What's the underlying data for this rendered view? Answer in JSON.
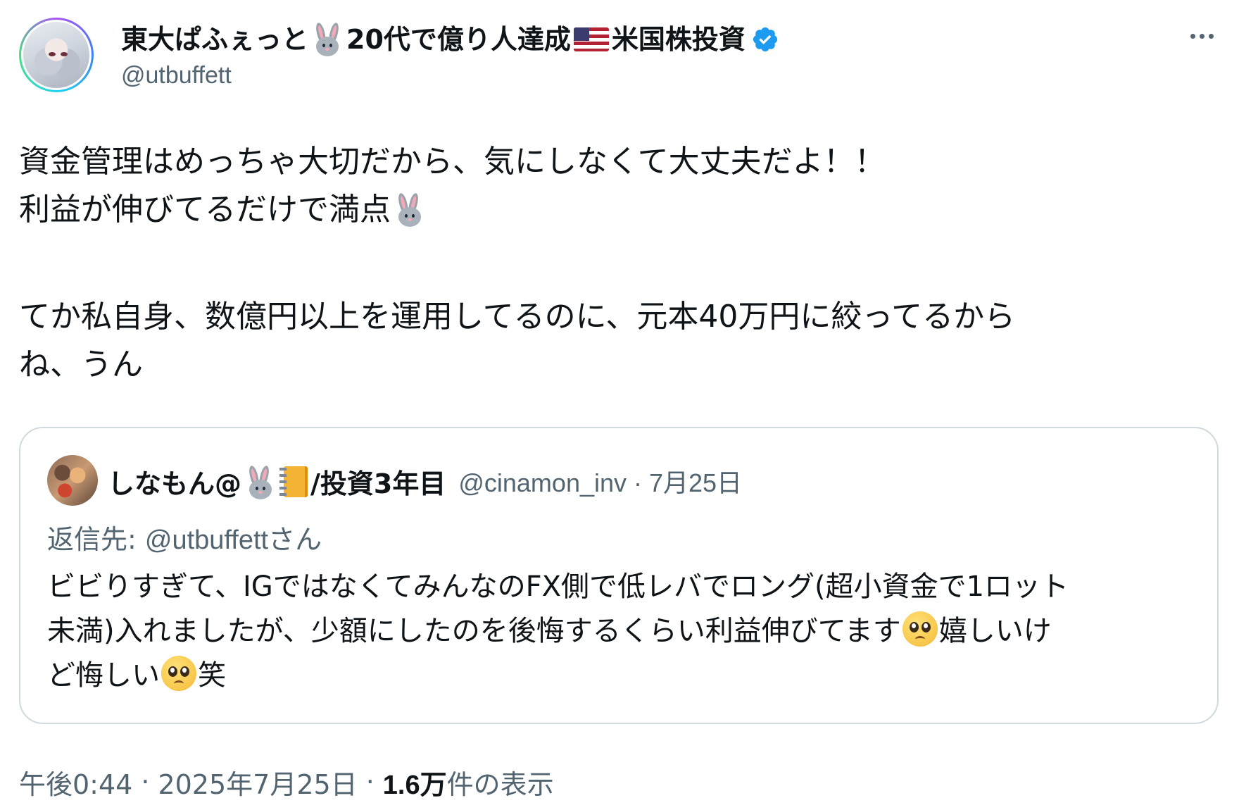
{
  "author": {
    "name_part1": "東大ぱふぇっと",
    "name_part2": "20代で億り人達成",
    "name_part3": "米国株投資",
    "handle": "@utbuffett",
    "verified": true,
    "emoji_icons": [
      "rabbit-face",
      "us-flag",
      "verified-badge"
    ]
  },
  "more_icon": "ellipsis-icon",
  "tweet": {
    "line1": "資金管理はめっちゃ大切だから、気にしなくて大丈夫だよ！！",
    "line2": "利益が伸びてるだけで満点",
    "line3": "てか私自身、数億円以上を運用してるのに、元本40万円に絞ってるから",
    "line4": "ね、うん"
  },
  "quote": {
    "name_part1": "しなもん@",
    "name_part2": "/投資3年目",
    "handle_date": "@cinamon_inv · 7月25日",
    "reply_label": "返信先: ",
    "reply_to": "@utbuffett",
    "reply_suffix": "さん",
    "text_line1": "ビビりすぎて、IGではなくてみんなのFX側で低レバでロング(超小資金で1ロット",
    "text_line2a": "未満)入れましたが、少額にしたのを後悔するくらい利益伸びてます",
    "text_line2b": "嬉しいけ",
    "text_line3a": "ど悔しい",
    "text_line3b": "笑"
  },
  "meta": {
    "time": "午後0:44",
    "dot": "·",
    "date": "2025年7月25日",
    "views_count": "1.6万",
    "views_label": " 件の表示"
  },
  "colors": {
    "text": "#0f1419",
    "secondary": "#536471",
    "border": "#cfd9de",
    "verified": "#1d9bf0"
  }
}
